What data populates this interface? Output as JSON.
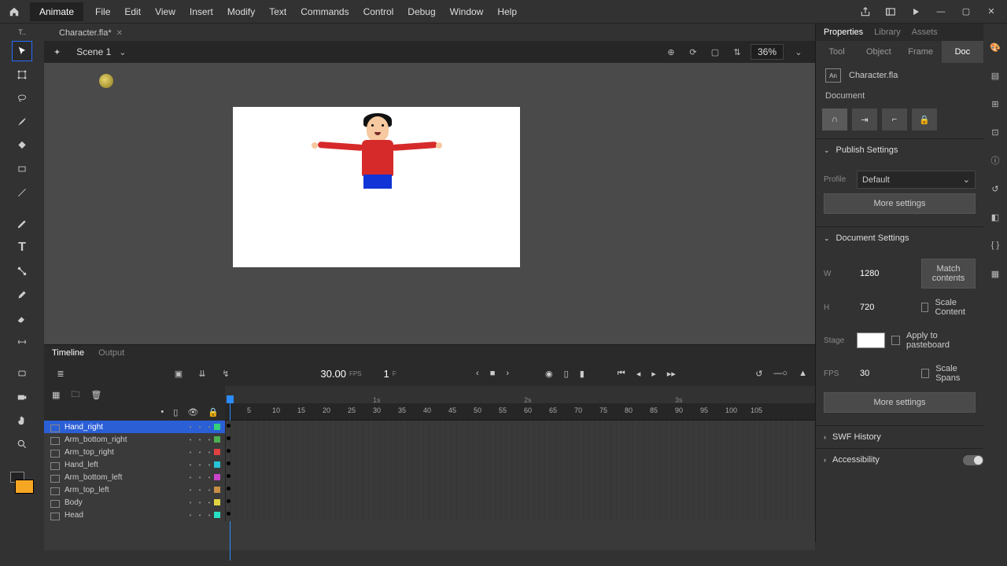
{
  "app": {
    "name": "Animate",
    "file_tab": "Character.fla*"
  },
  "menu": [
    "File",
    "Edit",
    "View",
    "Insert",
    "Modify",
    "Text",
    "Commands",
    "Control",
    "Debug",
    "Window",
    "Help"
  ],
  "scene": {
    "name": "Scene 1",
    "zoom": "36%"
  },
  "properties": {
    "tabs": [
      "Properties",
      "Library",
      "Assets"
    ],
    "subtabs": [
      "Tool",
      "Object",
      "Frame",
      "Doc"
    ],
    "docname": "Character.fla",
    "doclabel": "Document",
    "publish": {
      "header": "Publish Settings",
      "profile_label": "Profile",
      "profile": "Default",
      "more": "More settings"
    },
    "docset": {
      "header": "Document Settings",
      "wlabel": "W",
      "w": "1280",
      "hlabel": "H",
      "h": "720",
      "match": "Match contents",
      "scale_content": "Scale Content",
      "stage_label": "Stage",
      "apply_pb": "Apply to pasteboard",
      "fps_label": "FPS",
      "fps": "30",
      "scale_spans": "Scale Spans",
      "more": "More settings"
    },
    "swf": "SWF History",
    "access": "Accessibility"
  },
  "timeline": {
    "tabs": [
      "Timeline",
      "Output"
    ],
    "fps": "30.00",
    "fps_lbl": "FPS",
    "frame": "1",
    "frame_lbl": "F",
    "ruler_frames": [
      5,
      10,
      15,
      20,
      25,
      30,
      35,
      40,
      45,
      50,
      55,
      60,
      65,
      70,
      75,
      80,
      85,
      90,
      95,
      100,
      105
    ],
    "ruler_seconds": [
      "1s",
      "2s",
      "3s"
    ],
    "layers": [
      {
        "name": "Hand_right",
        "color": "#33d17a",
        "selected": true
      },
      {
        "name": "Arm_bottom_right",
        "color": "#4caf50"
      },
      {
        "name": "Arm_top_right",
        "color": "#e04141"
      },
      {
        "name": "Hand_left",
        "color": "#26c6da"
      },
      {
        "name": "Arm_bottom_left",
        "color": "#c944c9"
      },
      {
        "name": "Arm_top_left",
        "color": "#c98f44"
      },
      {
        "name": "Body",
        "color": "#e0d441"
      },
      {
        "name": "Head",
        "color": "#26e0c6"
      }
    ]
  }
}
